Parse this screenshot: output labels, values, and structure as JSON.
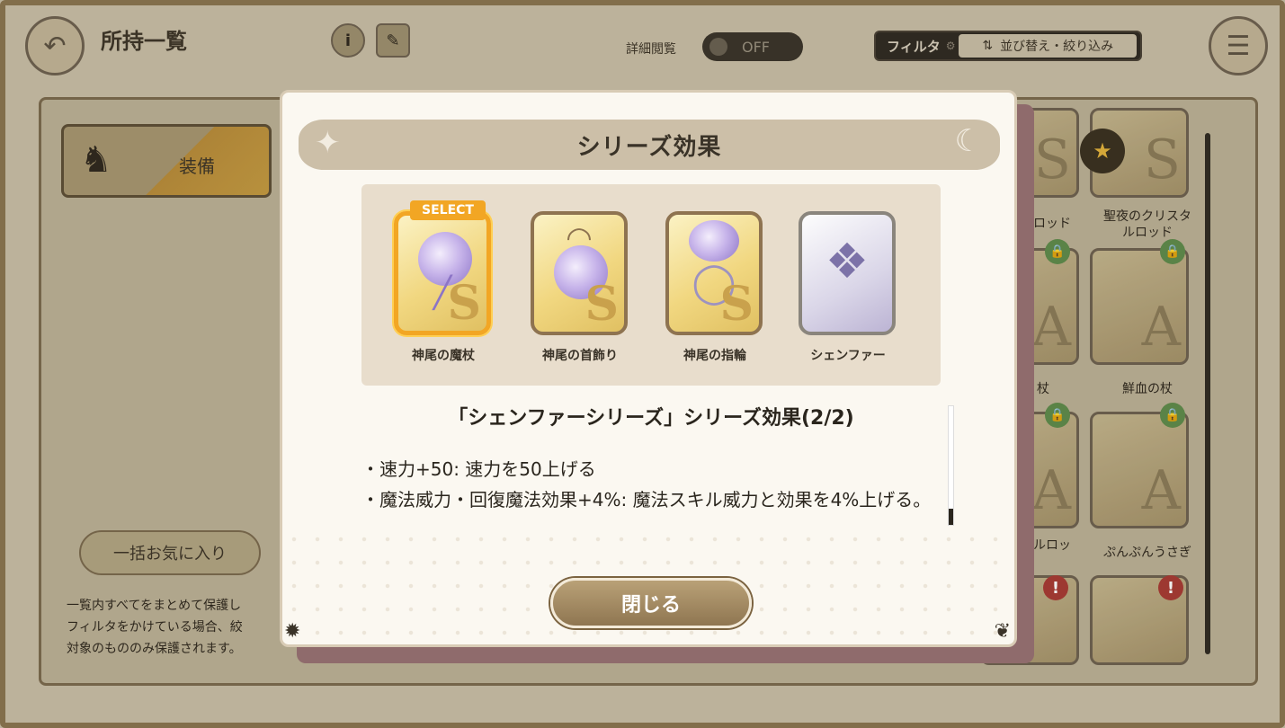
{
  "background": {
    "title": "所持一覧",
    "info_icon": "i",
    "detail_view_label": "詳細閲覧",
    "toggle_state": "OFF",
    "filter_label": "フィルタ",
    "sort_label": "並び替え・絞り込み",
    "equip_tab_label": "装備",
    "bulk_favorite_label": "一括お気に入り",
    "note_lines": [
      "一覧内すべてをまとめて保護し",
      "フィルタをかけている場合、絞",
      "対象のもののみ保護されます。"
    ],
    "grid_names": [
      "ロッド",
      "聖夜のクリスタ",
      "ルロッド",
      "杖",
      "鮮血の杖",
      "ルロッ",
      "ぷんぷんうさぎ"
    ]
  },
  "modal": {
    "title": "シリーズ効果",
    "select_badge": "SELECT",
    "items": [
      {
        "name": "神尾の魔杖",
        "selected": true,
        "icon": "wand-icon"
      },
      {
        "name": "神尾の首飾り",
        "selected": false,
        "icon": "necklace-icon"
      },
      {
        "name": "神尾の指輪",
        "selected": false,
        "icon": "ring-icon"
      },
      {
        "name": "シェンファー",
        "selected": false,
        "icon": "character-portrait-icon"
      }
    ],
    "effect_title": "「シェンファーシリーズ」シリーズ効果(2/2)",
    "effects": [
      "・速力+50: 速力を50上げる",
      "・魔法威力・回復魔法効果+4%: 魔法スキル威力と効果を4%上げる。"
    ],
    "close_label": "閉じる"
  },
  "colors": {
    "accent_select": "#f2a624",
    "modal_bg": "#fbf8f1",
    "header_bg": "#ccbfa8",
    "close_button": "#a68c64"
  }
}
